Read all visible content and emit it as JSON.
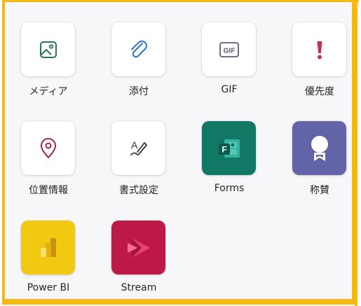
{
  "panel": {
    "accent_color": "#f6b90f",
    "items": [
      {
        "label": "メディア",
        "icon": "image-icon"
      },
      {
        "label": "添付",
        "icon": "paperclip-icon"
      },
      {
        "label": "GIF",
        "icon": "gif-icon"
      },
      {
        "label": "優先度",
        "icon": "exclamation-icon"
      },
      {
        "label": "位置情報",
        "icon": "location-pin-icon"
      },
      {
        "label": "書式設定",
        "icon": "format-text-icon"
      },
      {
        "label": "Forms",
        "icon": "forms-app-icon"
      },
      {
        "label": "称賛",
        "icon": "praise-badge-icon"
      },
      {
        "label": "Power BI",
        "icon": "power-bi-icon"
      },
      {
        "label": "Stream",
        "icon": "stream-icon"
      }
    ]
  },
  "colors": {
    "media": "#237b4b",
    "attach": "#2f74c0",
    "gif": "#5b5fc7",
    "priority": "#c4314b",
    "location": "#a4373a",
    "forms_bg": "#117865",
    "praise_bg": "#6264a7",
    "powerbi_bg": "#f2c811",
    "stream_bg": "#bc1948"
  }
}
